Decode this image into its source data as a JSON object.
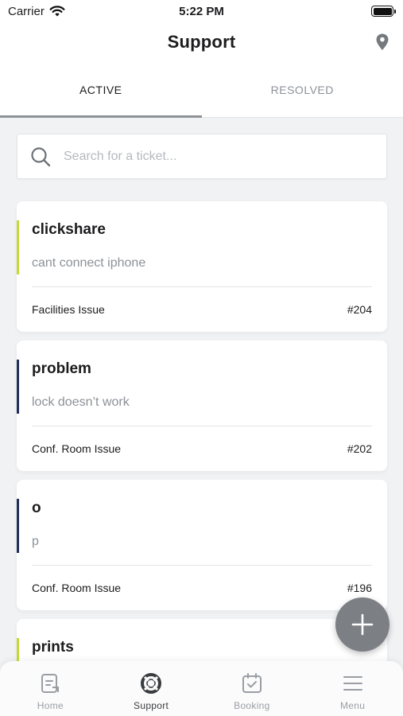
{
  "status_bar": {
    "carrier": "Carrier",
    "time": "5:22 PM"
  },
  "header": {
    "title": "Support",
    "location_icon": "location-pin-icon"
  },
  "tabs": [
    {
      "label": "ACTIVE",
      "active": true
    },
    {
      "label": "RESOLVED",
      "active": false
    }
  ],
  "search": {
    "placeholder": "Search for a ticket...",
    "value": ""
  },
  "tickets": [
    {
      "title": "clickshare",
      "description": "cant connect iphone",
      "category": "Facilities Issue",
      "number": "#204",
      "accent_color": "#c5d93a"
    },
    {
      "title": "problem",
      "description": "lock doesn’t work",
      "category": "Conf. Room Issue",
      "number": "#202",
      "accent_color": "#1f2f57"
    },
    {
      "title": "o",
      "description": "p",
      "category": "Conf. Room Issue",
      "number": "#196",
      "accent_color": "#1f2f57"
    },
    {
      "title": "prints",
      "description": "",
      "category": "",
      "number": "",
      "accent_color": "#c5d93a"
    }
  ],
  "fab": {
    "icon": "plus-icon",
    "color": "#7c7f84"
  },
  "bottom_nav": [
    {
      "label": "Home",
      "icon": "home-document-icon",
      "active": false
    },
    {
      "label": "Support",
      "icon": "lifebuoy-icon",
      "active": true
    },
    {
      "label": "Booking",
      "icon": "calendar-check-icon",
      "active": false
    },
    {
      "label": "Menu",
      "icon": "menu-icon",
      "active": false
    }
  ]
}
